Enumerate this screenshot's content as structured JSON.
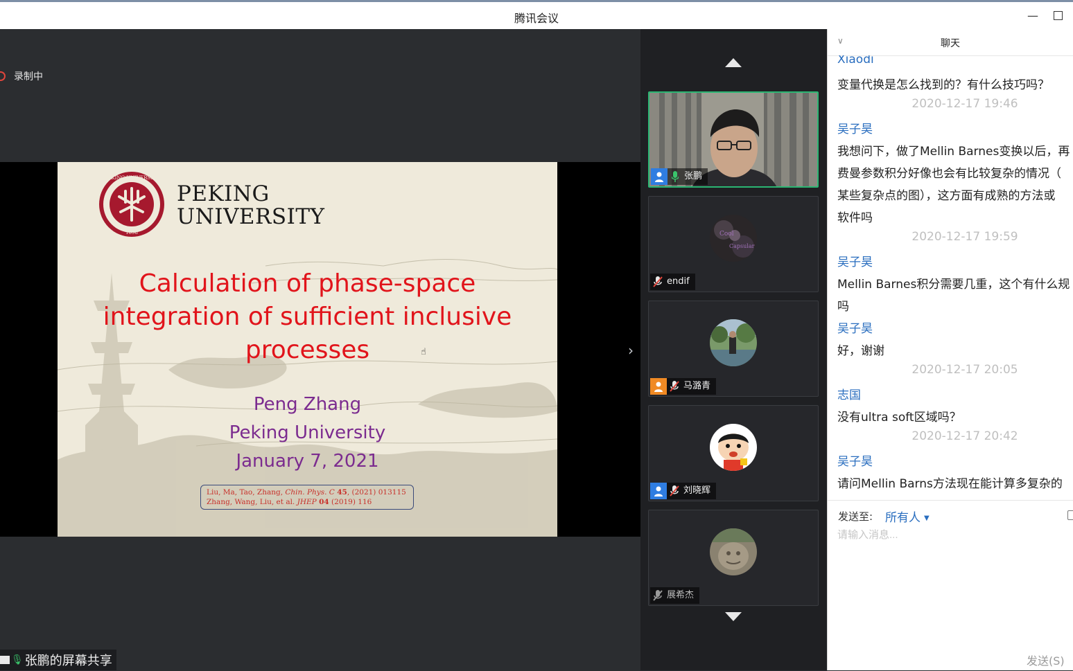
{
  "window": {
    "title": "腾讯会议",
    "minimize_icon": "minimize-icon",
    "maximize_icon": "maximize-icon"
  },
  "recording": {
    "label": "录制中",
    "color": "#e0453c"
  },
  "slide": {
    "university_name_line1": "PEKING",
    "university_name_line2": "UNIVERSITY",
    "seal_text": "PEKING UNIVERSITY",
    "seal_year": "1898",
    "title_line1": "Calculation of phase-space",
    "title_line2": "integration of sufficient inclusive",
    "title_line3": "processes",
    "author": "Peng Zhang",
    "affiliation": "Peking University",
    "date": "January 7, 2021",
    "ref1_authors": "Liu, Ma, Tao, Zhang,",
    "ref1_journal": "Chin. Phys. C",
    "ref1_volume": "45",
    "ref1_rest": ", (2021) 013115",
    "ref2_authors": "Zhang, Wang, Liu, et al.",
    "ref2_journal": "JHEP",
    "ref2_volume": "04",
    "ref2_rest": "(2019) 116",
    "title_color": "#e1141b",
    "author_color": "#7b2b8f"
  },
  "screen_share": {
    "label": "张鹏的屏幕共享"
  },
  "participants": [
    {
      "name": "张鹏",
      "mic": "on",
      "role_icon": "user-blue-icon",
      "video": true
    },
    {
      "name": "endif",
      "mic": "muted",
      "role_icon": "",
      "avatar": "galaxy-avatar"
    },
    {
      "name": "马潞青",
      "mic": "muted",
      "role_icon": "user-orange-icon",
      "avatar": "outdoor-photo-avatar"
    },
    {
      "name": "刘晓辉",
      "mic": "muted",
      "role_icon": "user-blue-icon",
      "avatar": "cartoon-avatar"
    },
    {
      "name": "展希杰",
      "mic": "muted",
      "role_icon": "",
      "avatar": "stone-sculpture-avatar"
    }
  ],
  "chat": {
    "header": "聊天",
    "messages": [
      {
        "kind": "sender",
        "text": "Xiaodi"
      },
      {
        "kind": "text",
        "text": "变量代换是怎么找到的？有什么技巧吗？"
      },
      {
        "kind": "time",
        "text": "2020-12-17 19:46"
      },
      {
        "kind": "sender",
        "text": "吴子昊"
      },
      {
        "kind": "text",
        "text": "我想问下，做了Mellin Barnes变换以后，再"
      },
      {
        "kind": "text",
        "text": "费曼参数积分好像也会有比较复杂的情况（"
      },
      {
        "kind": "text",
        "text": "某些复杂点的图），这方面有成熟的方法或"
      },
      {
        "kind": "text",
        "text": "软件吗"
      },
      {
        "kind": "time",
        "text": "2020-12-17 19:59"
      },
      {
        "kind": "sender",
        "text": "吴子昊"
      },
      {
        "kind": "text",
        "text": "Mellin Barnes积分需要几重，这个有什么规"
      },
      {
        "kind": "text",
        "text": "吗"
      },
      {
        "kind": "sender",
        "text": "吴子昊"
      },
      {
        "kind": "text",
        "text": "好，谢谢"
      },
      {
        "kind": "time",
        "text": "2020-12-17 20:05"
      },
      {
        "kind": "sender",
        "text": "志国"
      },
      {
        "kind": "text",
        "text": "没有ultra soft区域吗？"
      },
      {
        "kind": "time",
        "text": "2020-12-17 20:42"
      },
      {
        "kind": "sender",
        "text": "吴子昊"
      },
      {
        "kind": "text",
        "text": "请问Mellin Barns方法现在能计算多复杂的"
      }
    ],
    "send_to_label": "发送至:",
    "recipient": "所有人",
    "input_placeholder": "请输入消息...",
    "send_button": "发送(S)",
    "accent_color": "#2a6ebf"
  }
}
